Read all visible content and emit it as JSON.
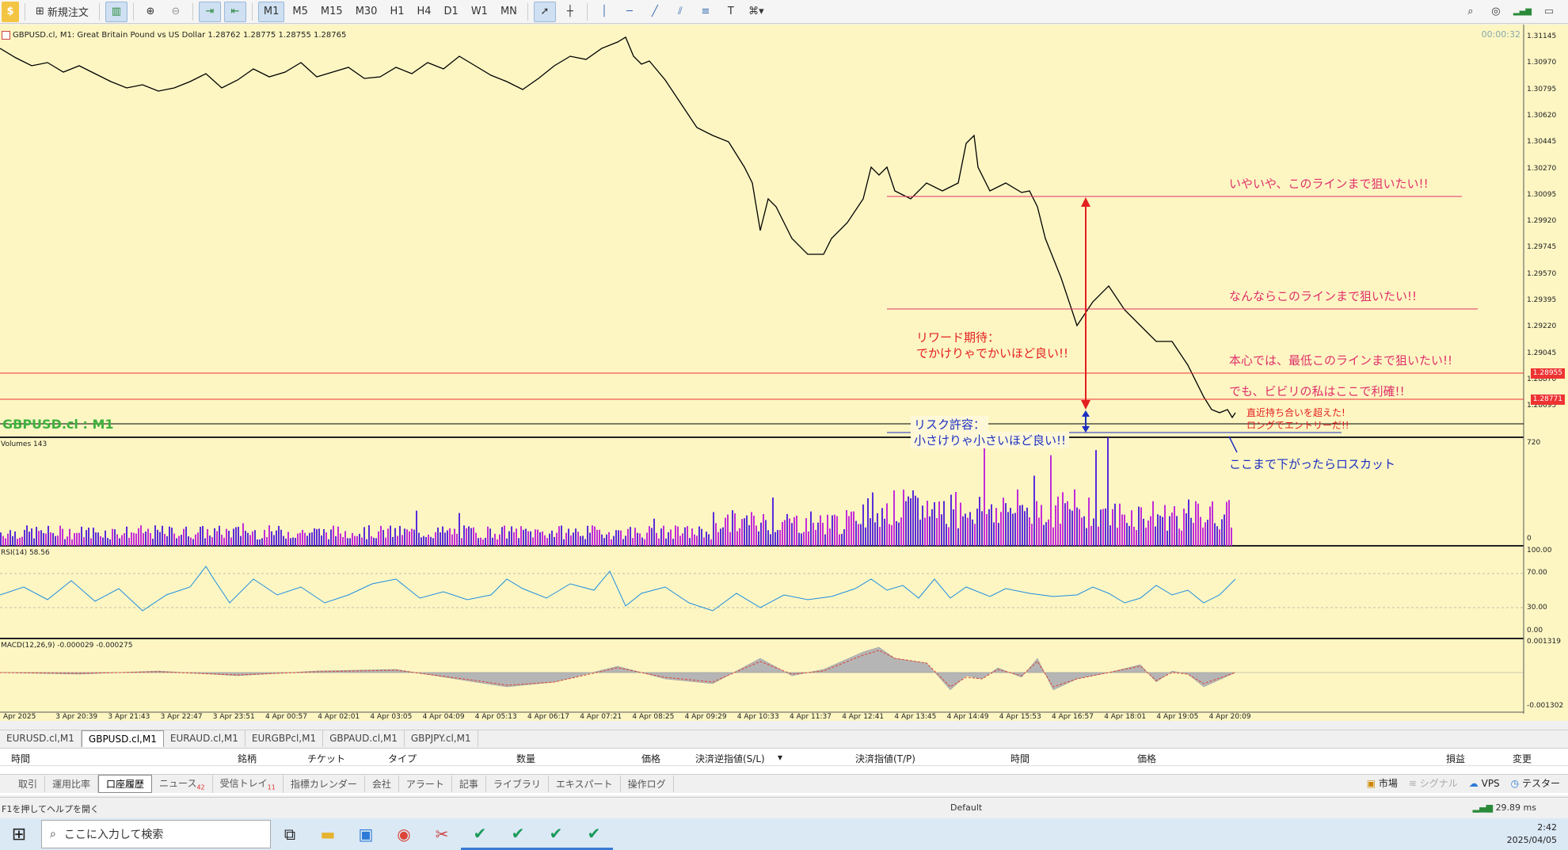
{
  "toolbar": {
    "new_order": "新規注文",
    "timeframes": [
      "M1",
      "M5",
      "M15",
      "M30",
      "H1",
      "H4",
      "D1",
      "W1",
      "MN"
    ],
    "active_timeframe": "M1"
  },
  "chart": {
    "header": "GBPUSD.cl, M1:  Great Britain Pound vs US Dollar  1.28762 1.28775 1.28755 1.28765",
    "timer": "00:00:32",
    "symbol_label": "GBPUSD.cl : M1",
    "price_labels": [
      "1.31145",
      "1.30970",
      "1.30795",
      "1.30620",
      "1.30445",
      "1.30270",
      "1.30095",
      "1.29920",
      "1.29745",
      "1.29570",
      "1.29395",
      "1.29220",
      "1.29045",
      "1.28870",
      "1.28695"
    ],
    "tag_upper": "1.28955",
    "tag_lower": "1.28771",
    "volumes_label": "Volumes 143",
    "volumes_axis": [
      "720",
      "0"
    ],
    "rsi_label": "RSI(14) 58.56",
    "rsi_axis": [
      "100.00",
      "70.00",
      "30.00",
      "0.00"
    ],
    "macd_label": "MACD(12,26,9) -0.000029 -0.000275",
    "macd_axis": [
      "0.001319",
      "-0.001302"
    ],
    "time_labels": [
      "Apr 2025",
      "3 Apr 20:39",
      "3 Apr 21:43",
      "3 Apr 22:47",
      "3 Apr 23:51",
      "4 Apr 00:57",
      "4 Apr 02:01",
      "4 Apr 03:05",
      "4 Apr 04:09",
      "4 Apr 05:13",
      "4 Apr 06:17",
      "4 Apr 07:21",
      "4 Apr 08:25",
      "4 Apr 09:29",
      "4 Apr 10:33",
      "4 Apr 11:37",
      "4 Apr 12:41",
      "4 Apr 13:45",
      "4 Apr 14:49",
      "4 Apr 15:53",
      "4 Apr 16:57",
      "4 Apr 18:01",
      "4 Apr 19:05",
      "4 Apr 20:09"
    ]
  },
  "annotations": {
    "line1": "いやいや、このラインまで狙いたい!!",
    "line2": "なんならこのラインまで狙いたい!!",
    "line3": "本心では、最低このラインまで狙いたい!!",
    "line4": "でも、ビビリの私はここで利確!!",
    "reward_1": "リワード期待：",
    "reward_2": "でかけりゃでかいほど良い!!",
    "risk_1": "リスク許容：",
    "risk_2": "小さけりゃ小さいほど良い!!",
    "entry_1": "直近持ち合いを超えた!",
    "entry_2": "ロングでエントリーだ!!",
    "stop": "ここまで下がったらロスカット"
  },
  "symbol_tabs": [
    "EURUSD.cl,M1",
    "GBPUSD.cl,M1",
    "EURAUD.cl,M1",
    "EURGBPcl,M1",
    "GBPAUD.cl,M1",
    "GBPJPY.cl,M1"
  ],
  "terminal": {
    "headers": [
      "時間",
      "銘柄",
      "チケット",
      "タイプ",
      "数量",
      "価格",
      "決済逆指値(S/L)",
      "決済指値(T/P)",
      "時間",
      "価格",
      "損益",
      "変更"
    ],
    "tabs": [
      "取引",
      "運用比率",
      "口座履歴",
      "ニュース",
      "受信トレイ",
      "指標カレンダー",
      "会社",
      "アラート",
      "記事",
      "ライブラリ",
      "エキスパート",
      "操作ログ"
    ],
    "active_tab": "口座履歴",
    "news_badge": "42",
    "inbox_badge": "11",
    "right_items": [
      "市場",
      "シグナル",
      "VPS",
      "テスター"
    ]
  },
  "status": {
    "help": "F1を押してヘルプを開く",
    "profile": "Default",
    "ping": "29.89 ms"
  },
  "taskbar": {
    "search_placeholder": "ここに入力して検索",
    "time": "2:42",
    "date": "2025/04/05"
  }
}
